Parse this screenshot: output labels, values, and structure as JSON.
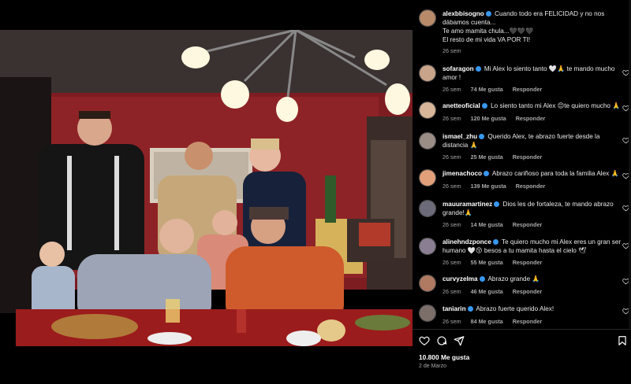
{
  "colors": {
    "background": "#000000",
    "meta": "#a8a8a8",
    "verified": "#3897f0",
    "wall": "#8a1e22",
    "tablecloth": "#9b1c1c"
  },
  "post": {
    "photo_alt": "Family dinner photo"
  },
  "comments": [
    {
      "username": "alexbbisogno",
      "verified": true,
      "text": "Cuando todo era FELICIDAD y no nos dábamos cuenta...",
      "text2": "Te amo mamita chula...🖤🖤🖤",
      "text3": "El resto de mi vida VA POR TI!",
      "meta_time": "26 sem",
      "likes": "",
      "reply": "",
      "avatar_color": "#b88a6a"
    },
    {
      "username": "sofaragon",
      "verified": true,
      "text": "Mi Alex lo siento tanto 🤍🙏 te mando mucho amor !",
      "meta_time": "26 sem",
      "likes": "74 Me gusta",
      "reply": "Responder",
      "avatar_color": "#c9a48a"
    },
    {
      "username": "anetteoficial",
      "verified": true,
      "text": "Lo siento tanto mi Alex 😔te quiero mucho 🙏",
      "meta_time": "26 sem",
      "likes": "120 Me gusta",
      "reply": "Responder",
      "avatar_color": "#d8b69a"
    },
    {
      "username": "ismael_zhu",
      "verified": true,
      "text": "Querido Alex, te abrazo fuerte desde la distancia 🙏",
      "meta_time": "26 sem",
      "likes": "25 Me gusta",
      "reply": "Responder",
      "avatar_color": "#9a8d86"
    },
    {
      "username": "jimenachoco",
      "verified": true,
      "text": "Abrazo cariñoso para toda la familia Alex 🙏",
      "meta_time": "26 sem",
      "likes": "139 Me gusta",
      "reply": "Responder",
      "avatar_color": "#e2a07a"
    },
    {
      "username": "mauuramartinez",
      "verified": true,
      "text": "Dios les de fortaleza, te mando abrazo grande!🙏",
      "meta_time": "26 sem",
      "likes": "14 Me gusta",
      "reply": "Responder",
      "avatar_color": "#6b6b7a"
    },
    {
      "username": "alinehndzponce",
      "verified": true,
      "text": "Te quiero mucho mi Alex eres un gran ser humano 🤍😚 besos a tu mamita hasta el cielo 🕊",
      "meta_time": "26 sem",
      "likes": "55 Me gusta",
      "reply": "Responder",
      "avatar_color": "#8a7f92"
    },
    {
      "username": "curvyzelma",
      "verified": true,
      "text": "Abrazo grande 🙏",
      "meta_time": "26 sem",
      "likes": "46 Me gusta",
      "reply": "Responder",
      "avatar_color": "#b07a62"
    },
    {
      "username": "taniarin",
      "verified": true,
      "text": "Abrazo fuerte querido Alex!",
      "meta_time": "26 sem",
      "likes": "84 Me gusta",
      "reply": "Responder",
      "avatar_color": "#7c6f6a"
    }
  ],
  "footer": {
    "likes": "10.800 Me gusta",
    "date": "2 de Marzo"
  },
  "icons": {
    "like": "heart-icon",
    "comment": "comment-icon",
    "share": "share-icon",
    "save": "bookmark-icon"
  }
}
